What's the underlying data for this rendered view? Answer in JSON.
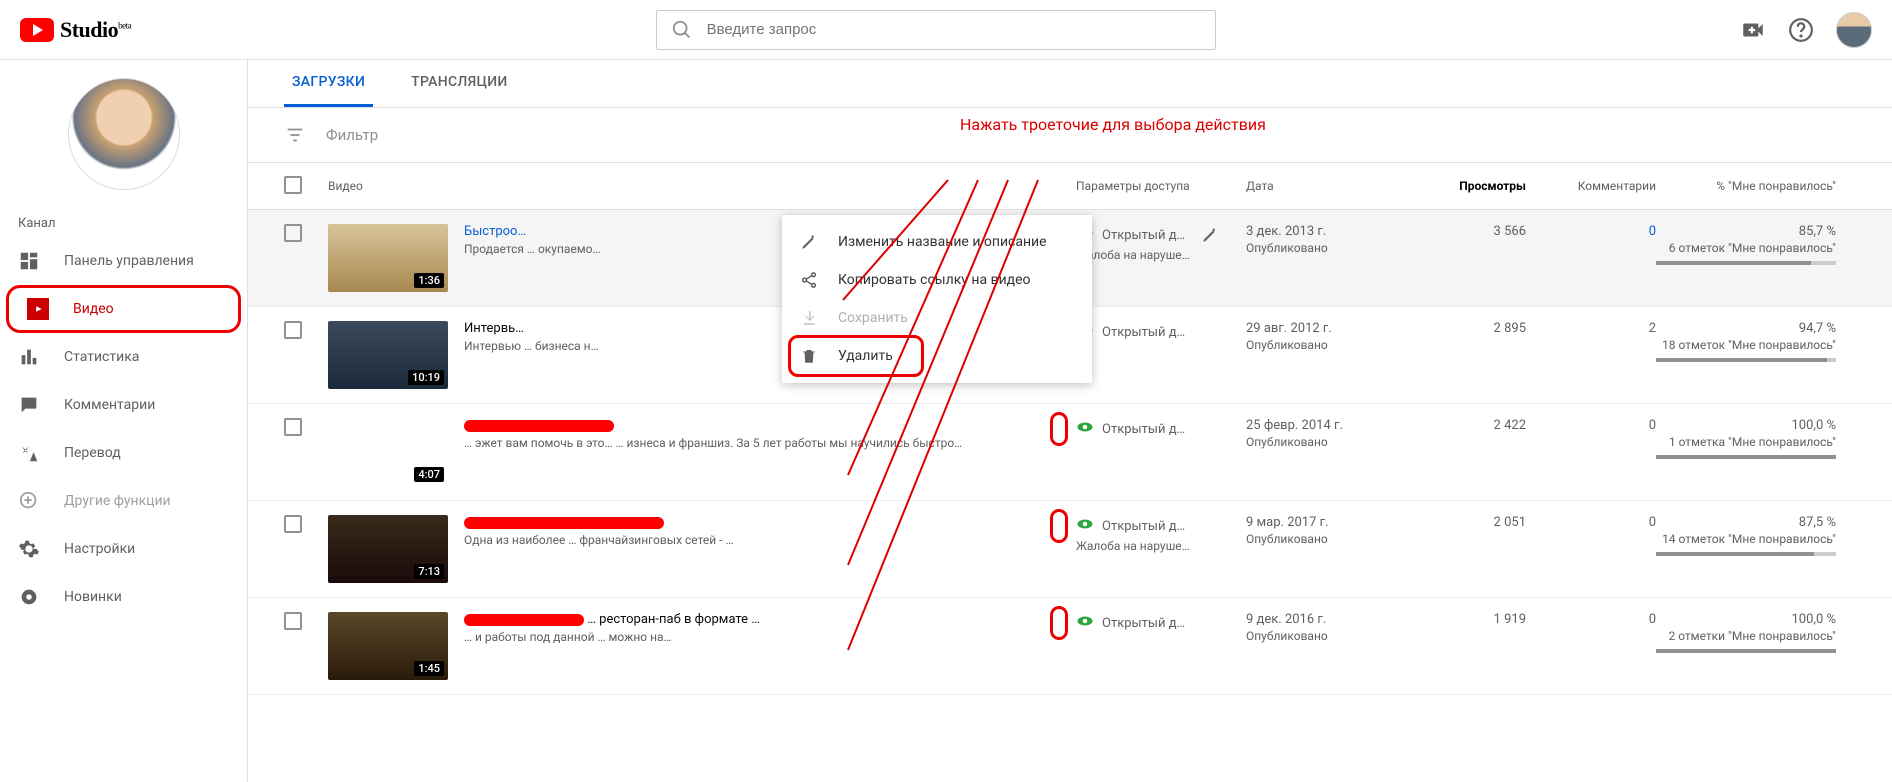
{
  "app": {
    "name": "Studio",
    "beta": "beta"
  },
  "search": {
    "placeholder": "Введите запрос"
  },
  "sidebar": {
    "channel_label": "Канал",
    "items": [
      {
        "label": "Панель управления"
      },
      {
        "label": "Видео"
      },
      {
        "label": "Статистика"
      },
      {
        "label": "Комментарии"
      },
      {
        "label": "Перевод"
      },
      {
        "label": "Другие функции"
      },
      {
        "label": "Настройки"
      },
      {
        "label": "Новинки"
      }
    ]
  },
  "tabs": {
    "uploads": "ЗАГРУЗКИ",
    "live": "ТРАНСЛЯЦИИ"
  },
  "filter": "Фильтр",
  "columns": {
    "video": "Видео",
    "access": "Параметры доступа",
    "date": "Дата",
    "views": "Просмотры",
    "comments": "Комментарии",
    "likes": "% \"Мне понравилось\""
  },
  "menu": {
    "edit": "Изменить название и описание",
    "copy": "Копировать ссылку на видео",
    "save": "Сохранить",
    "delete": "Удалить"
  },
  "annotation": "Нажать троеточие для выбора действия",
  "rows": [
    {
      "title": "Быстроо…",
      "desc": "Продается … окупаемо…",
      "dur": "1:36",
      "access": "Открытый д…",
      "access_sub": "Жалоба на наруше…",
      "date": "3 дек. 2013 г.",
      "date_sub": "Опубликовано",
      "views": "3 566",
      "comments": "0",
      "likes": "85,7 %",
      "likes_sub": "6 отметок \"Мне понравилось\"",
      "bar": 86,
      "comments_link": true
    },
    {
      "title": "Интервь…",
      "desc": "Интервью … бизнеса н…",
      "dur": "10:19",
      "access": "Открытый д…",
      "access_sub": "",
      "date": "29 авг. 2012 г.",
      "date_sub": "Опубликовано",
      "views": "2 895",
      "comments": "2",
      "likes": "94,7 %",
      "likes_sub": "18 отметок \"Мне понравилось\"",
      "bar": 95
    },
    {
      "title": "",
      "desc": "… эжет вам помочь в это… … изнеса и франшиз. За 5 лет работы мы научились быстро…",
      "dur": "4:07",
      "access": "Открытый д…",
      "access_sub": "",
      "date": "25 февр. 2014 г.",
      "date_sub": "Опубликовано",
      "views": "2 422",
      "comments": "0",
      "likes": "100,0 %",
      "likes_sub": "1 отметка \"Мне понравилось\"",
      "bar": 100
    },
    {
      "title": "",
      "desc": "Одна из наиболее … франчайзинговых сетей - …",
      "dur": "7:13",
      "access": "Открытый д…",
      "access_sub": "Жалоба на наруше…",
      "date": "9 мар. 2017 г.",
      "date_sub": "Опубликовано",
      "views": "2 051",
      "comments": "0",
      "likes": "87,5 %",
      "likes_sub": "14 отметок \"Мне понравилось\"",
      "bar": 88
    },
    {
      "title": "… ресторан-паб в формате …",
      "desc": "… и работы под данной … можно на…",
      "dur": "1:45",
      "access": "Открытый д…",
      "access_sub": "",
      "date": "9 дек. 2016 г.",
      "date_sub": "Опубликовано",
      "views": "1 919",
      "comments": "0",
      "likes": "100,0 %",
      "likes_sub": "2 отметки \"Мне понравилось\"",
      "bar": 100
    }
  ]
}
